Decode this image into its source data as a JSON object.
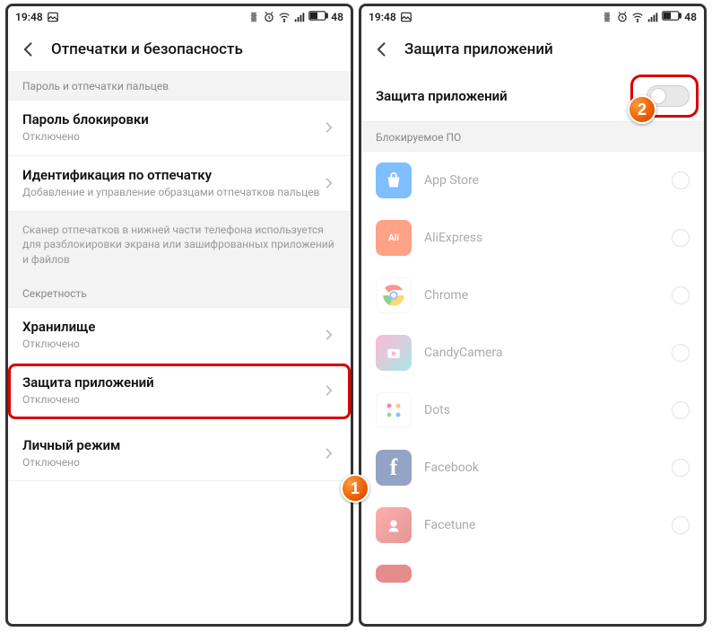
{
  "status": {
    "time": "19:48",
    "battery": "48"
  },
  "left": {
    "title": "Отпечатки и безопасность",
    "section1": "Пароль и отпечатки пальцев",
    "row_password_title": "Пароль блокировки",
    "row_password_sub": "Отключено",
    "row_fp_title": "Идентификация по отпечатку",
    "row_fp_sub": "Добавление и управление образцами отпечатков пальцев",
    "info": "Сканер отпечатков в нижней части телефона используется для разблокировки экрана или зашифрованных приложений и файлов",
    "section2": "Секретность",
    "row_storage_title": "Хранилище",
    "row_storage_sub": "Отключено",
    "row_appprotect_title": "Защита приложений",
    "row_appprotect_sub": "Отключено",
    "row_private_title": "Личный режим",
    "row_private_sub": "Отключено"
  },
  "right": {
    "title": "Защита приложений",
    "toggle_label": "Защита приложений",
    "section": "Блокируемое ПО",
    "apps": {
      "a0": "App Store",
      "a1": "AliExpress",
      "a2": "Chrome",
      "a3": "CandyCamera",
      "a4": "Dots",
      "a5": "Facebook",
      "a6": "Facetune"
    }
  },
  "badges": {
    "one": "1",
    "two": "2"
  }
}
